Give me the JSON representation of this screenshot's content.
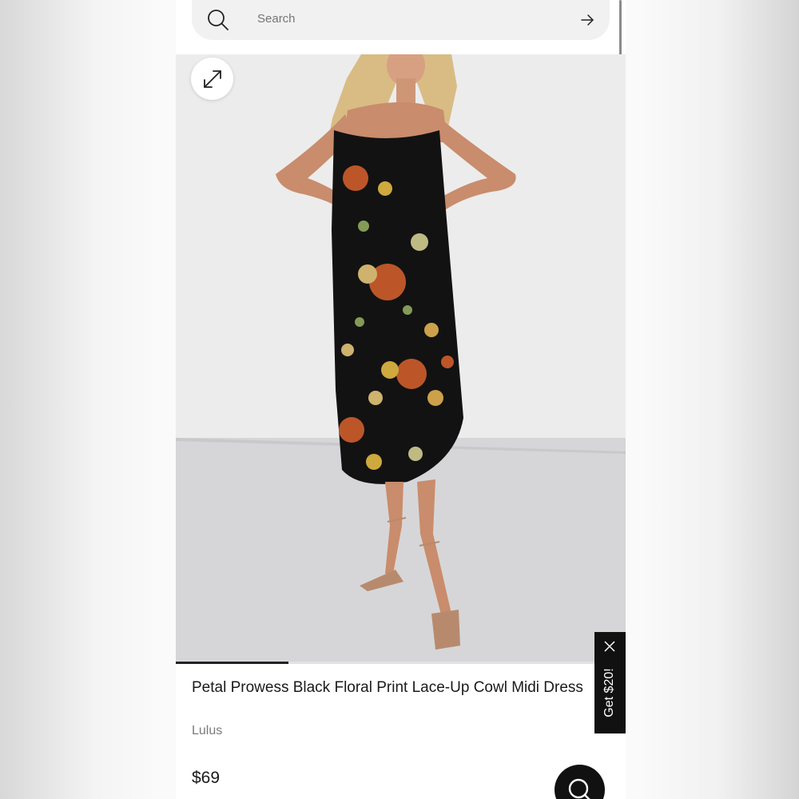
{
  "search": {
    "placeholder": "Search"
  },
  "icons": {
    "search": "search-icon",
    "arrow": "arrow-right-icon",
    "expand": "expand-icon",
    "close": "close-icon",
    "chat": "chat-search-icon"
  },
  "gallery": {
    "progress_fraction": 0.25
  },
  "product": {
    "title": "Petal Prowess Black Floral Print Lace-Up Cowl Midi Dress",
    "brand": "Lulus",
    "price": "$69"
  },
  "promo": {
    "label": "Get $20!"
  },
  "colors": {
    "accent": "#111111",
    "muted_text": "#7a7a7a",
    "search_bg": "#f1f1f1"
  }
}
